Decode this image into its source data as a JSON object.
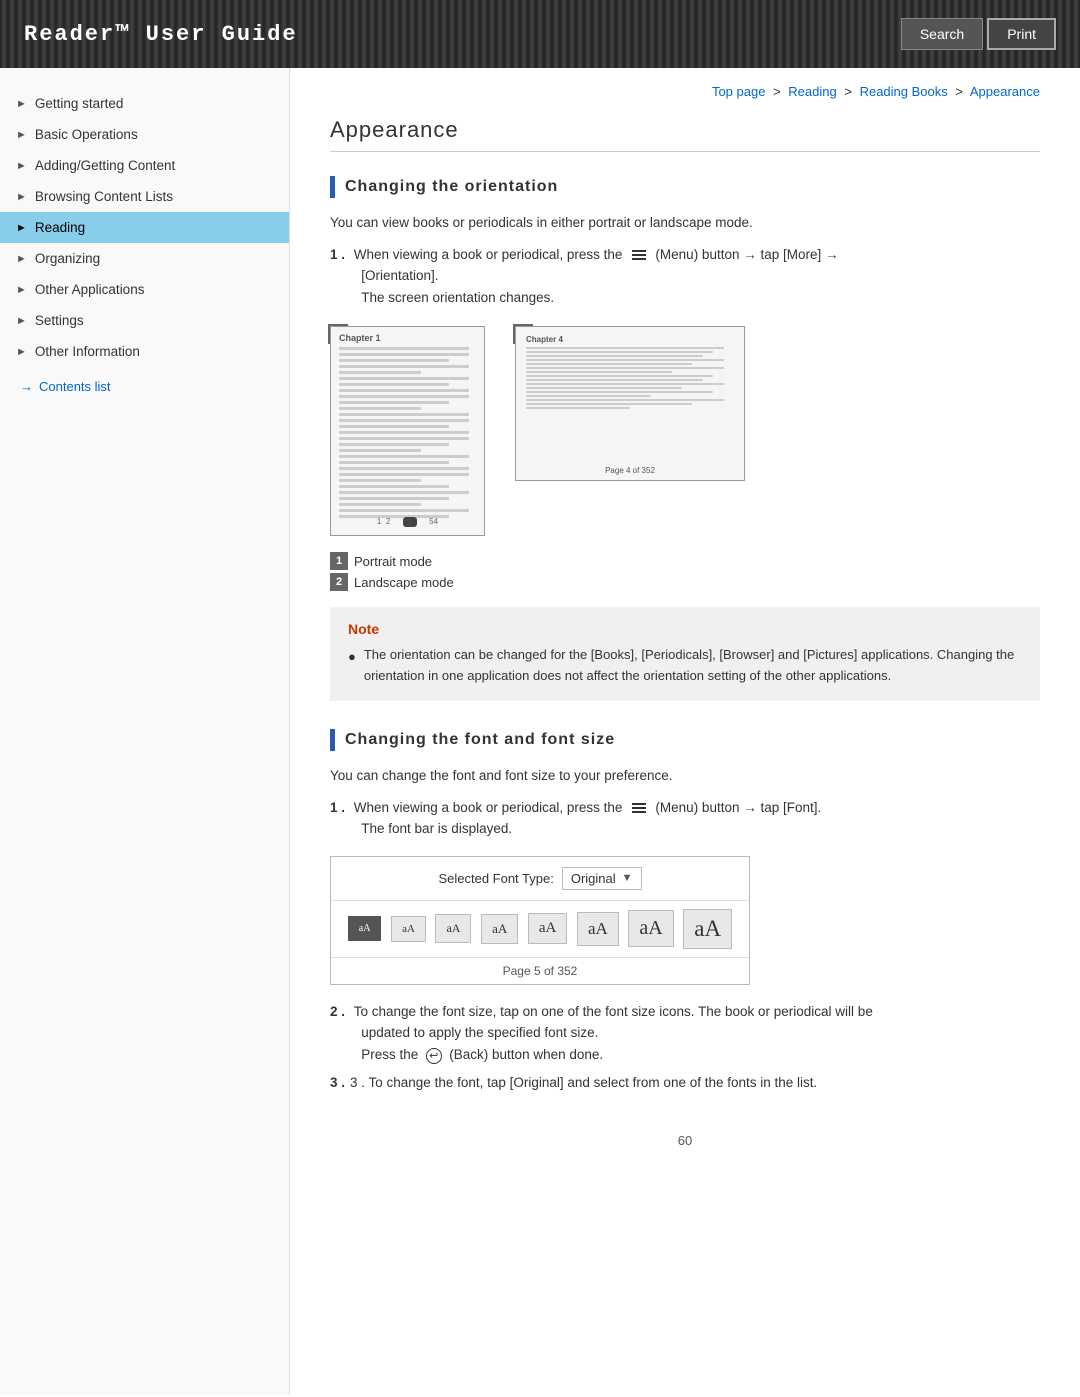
{
  "header": {
    "title": "Reader™ User Guide",
    "search_label": "Search",
    "print_label": "Print"
  },
  "breadcrumb": {
    "items": [
      "Top page",
      "Reading",
      "Reading Books",
      "Appearance"
    ],
    "separator": ">"
  },
  "sidebar": {
    "items": [
      {
        "id": "getting-started",
        "label": "Getting started",
        "active": false
      },
      {
        "id": "basic-operations",
        "label": "Basic Operations",
        "active": false
      },
      {
        "id": "adding-content",
        "label": "Adding/Getting Content",
        "active": false
      },
      {
        "id": "browsing-content",
        "label": "Browsing Content Lists",
        "active": false
      },
      {
        "id": "reading",
        "label": "Reading",
        "active": true
      },
      {
        "id": "organizing",
        "label": "Organizing",
        "active": false
      },
      {
        "id": "other-applications",
        "label": "Other Applications",
        "active": false
      },
      {
        "id": "settings",
        "label": "Settings",
        "active": false
      },
      {
        "id": "other-information",
        "label": "Other Information",
        "active": false
      }
    ],
    "contents_link": "Contents list"
  },
  "page": {
    "title": "Appearance",
    "section1": {
      "heading": "Changing the orientation",
      "intro": "You can view books or periodicals in either portrait or landscape mode.",
      "step1_prefix": "1 .  When viewing a book or periodical, press the",
      "step1_menu": "(Menu) button",
      "step1_suffix": "tap [More]",
      "step1_orientation": "[Orientation].",
      "step1_result": "The screen orientation changes.",
      "portrait_label": "Portrait mode",
      "landscape_label": "Landscape mode",
      "note_title": "Note",
      "note_text": "The orientation can be changed for the [Books], [Periodicals], [Browser] and [Pictures] applications. Changing the orientation in one application does not affect the orientation setting of the other applications."
    },
    "section2": {
      "heading": "Changing the font and font size",
      "intro": "You can change the font and font size to your preference.",
      "step1_prefix": "1 .  When viewing a book or periodical, press the",
      "step1_menu": "(Menu) button",
      "step1_suffix": "tap [Font].",
      "step1_result": "The font bar is displayed.",
      "font_bar": {
        "selected_font_label": "Selected Font Type:",
        "selected_font_value": "Original",
        "sizes": [
          "aA",
          "aA",
          "aA",
          "aA",
          "aA",
          "aA",
          "aA",
          "aA"
        ],
        "page_label": "Page 5 of 352"
      },
      "step2": "2 .  To change the font size, tap on one of the font size icons. The book or periodical will be updated to apply the specified font size.",
      "step2b": "Press the",
      "step2b_icon": "(Back) button when done.",
      "step3": "3 .  To change the font, tap [Original] and select from one of the fonts in the list."
    }
  },
  "footer": {
    "page_number": "60"
  }
}
